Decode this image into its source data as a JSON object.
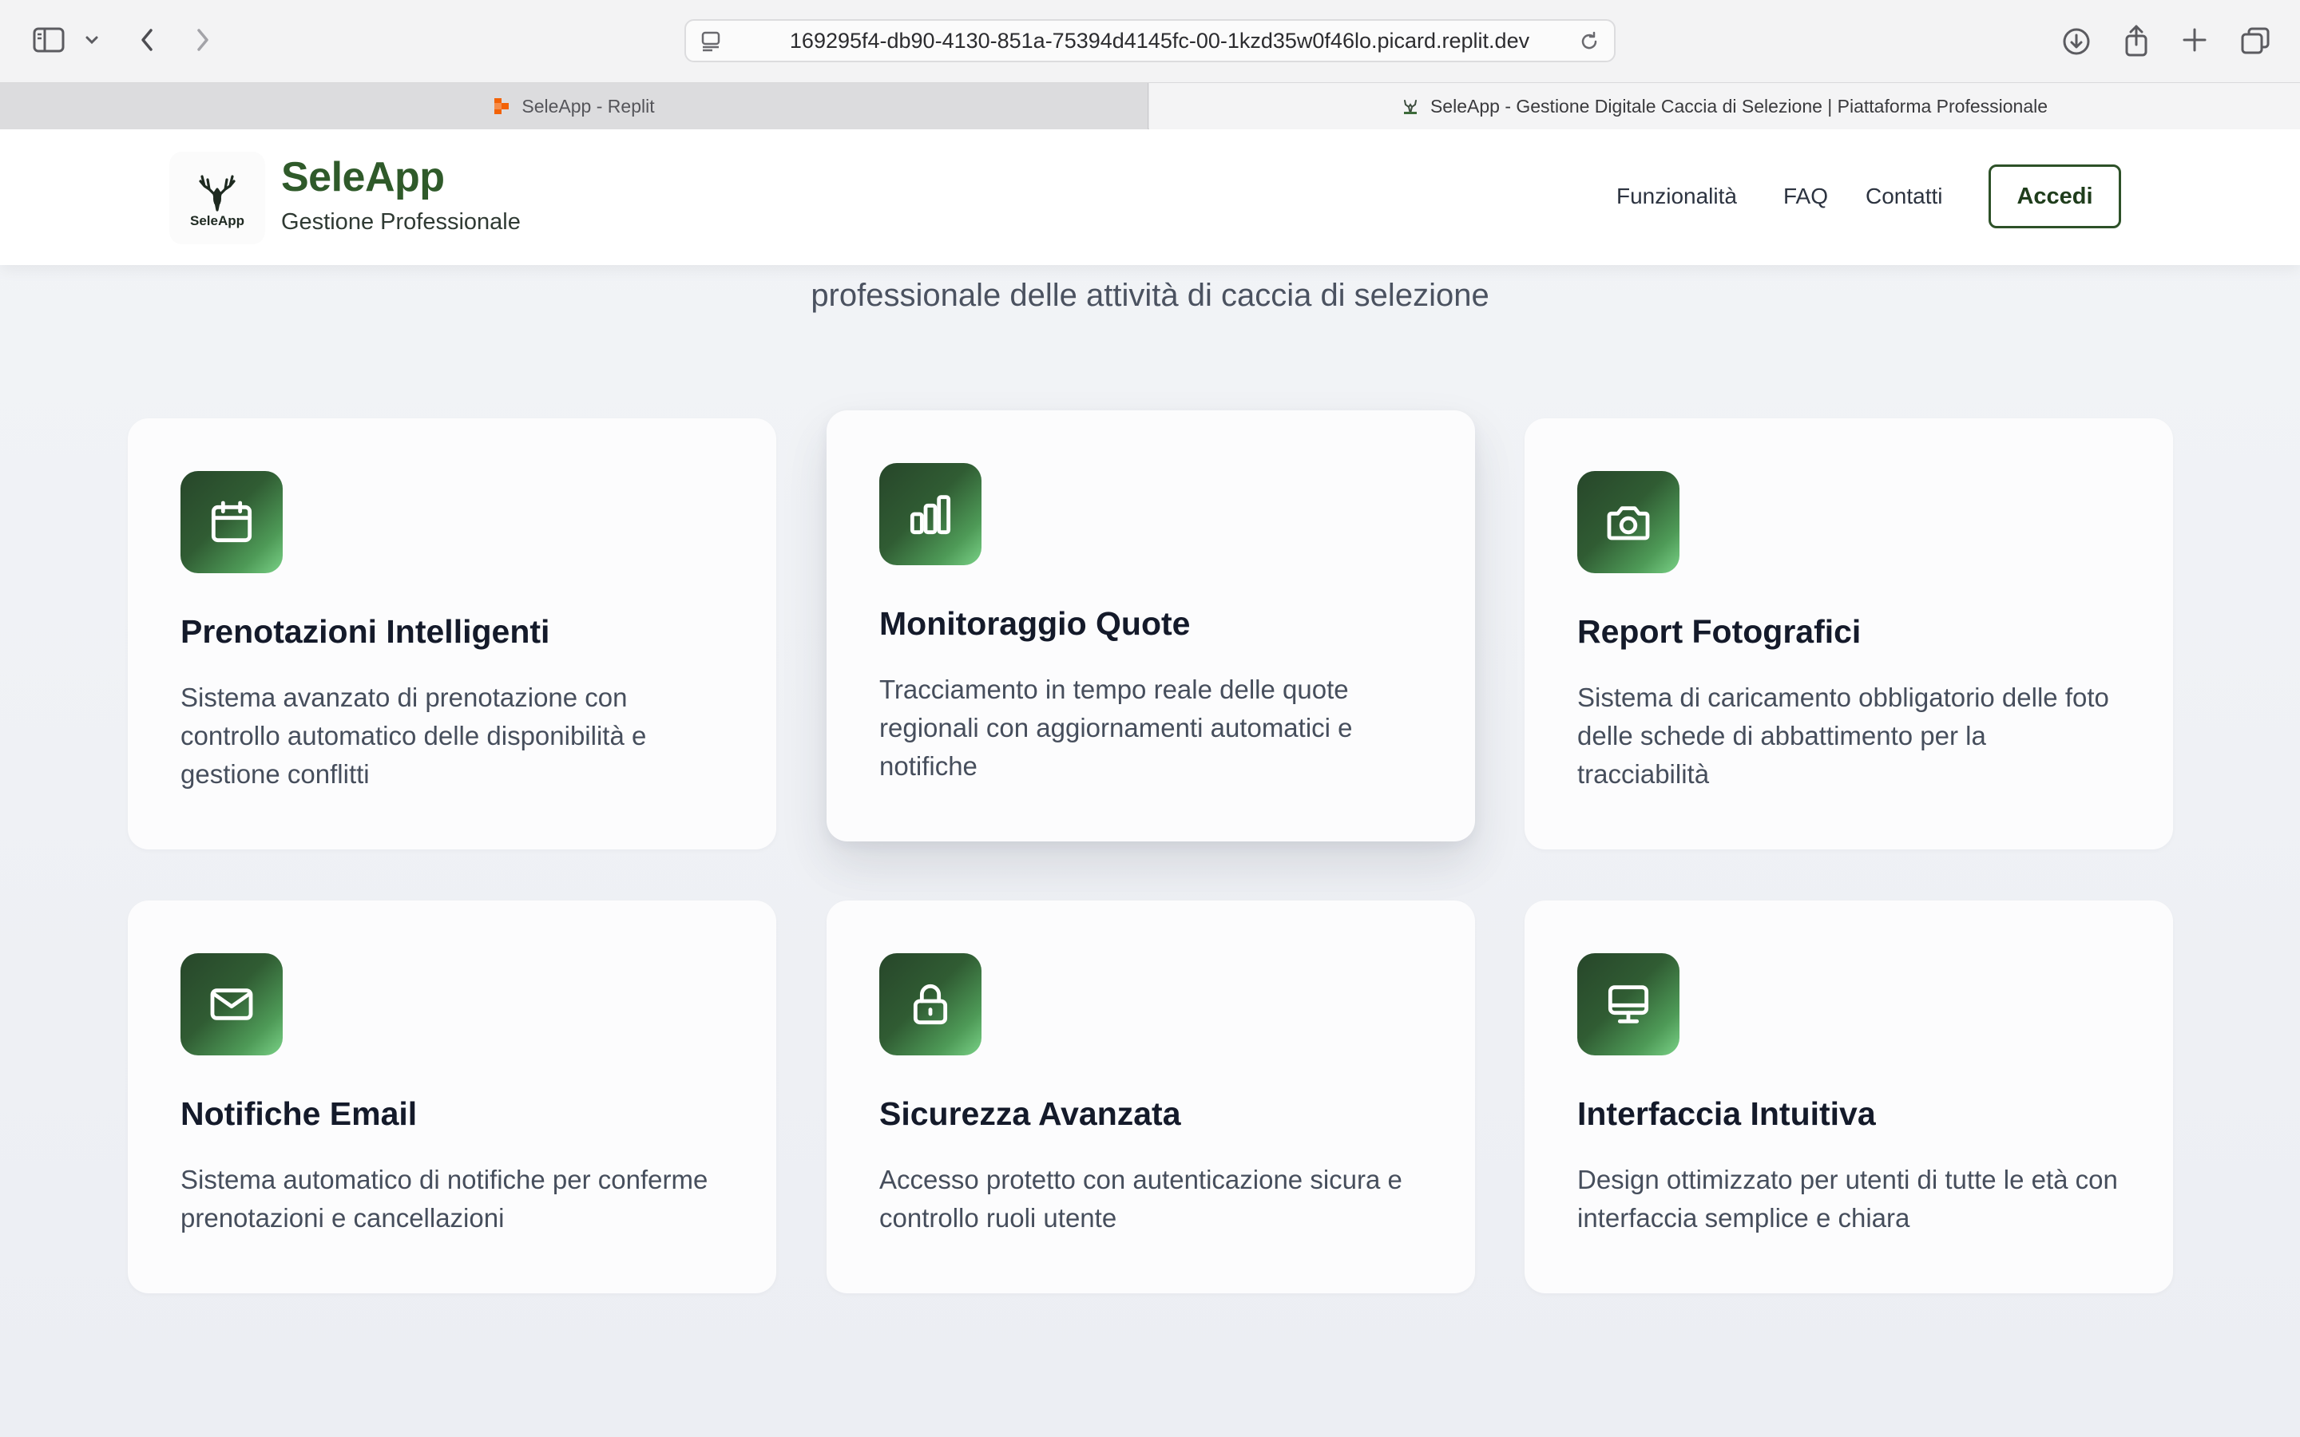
{
  "browser": {
    "url": "169295f4-db90-4130-851a-75394d4145fc-00-1kzd35w0f46lo.picard.replit.dev",
    "tabs": [
      {
        "title": "SeleApp - Replit",
        "active": false
      },
      {
        "title": "SeleApp - Gestione Digitale Caccia di Selezione | Piattaforma Professionale",
        "active": true
      }
    ]
  },
  "header": {
    "logo_caption": "SeleApp",
    "brand_name": "SeleApp",
    "brand_subtitle": "Gestione Professionale",
    "nav": [
      "Funzionalità",
      "FAQ",
      "Contatti"
    ],
    "login_label": "Accedi"
  },
  "hero": {
    "subtitle_line2": "professionale delle attività di caccia di selezione"
  },
  "colors": {
    "brand_green": "#2f5a2a",
    "icon_gradient_start": "#27462a",
    "icon_gradient_end": "#7ad287"
  },
  "features": [
    {
      "icon": "calendar-icon",
      "title": "Prenotazioni Intelligenti",
      "description": "Sistema avanzato di prenotazione con controllo automatico delle disponibilità e gestione conflitti"
    },
    {
      "icon": "bar-chart-icon",
      "title": "Monitoraggio Quote",
      "description": "Tracciamento in tempo reale delle quote regionali con aggiornamenti automatici e notifiche"
    },
    {
      "icon": "camera-icon",
      "title": "Report Fotografici",
      "description": "Sistema di caricamento obbligatorio delle foto delle schede di abbattimento per la tracciabilità"
    },
    {
      "icon": "mail-icon",
      "title": "Notifiche Email",
      "description": "Sistema automatico di notifiche per conferme prenotazioni e cancellazioni"
    },
    {
      "icon": "lock-icon",
      "title": "Sicurezza Avanzata",
      "description": "Accesso protetto con autenticazione sicura e controllo ruoli utente"
    },
    {
      "icon": "monitor-icon",
      "title": "Interfaccia Intuitiva",
      "description": "Design ottimizzato per utenti di tutte le età con interfaccia semplice e chiara"
    }
  ]
}
